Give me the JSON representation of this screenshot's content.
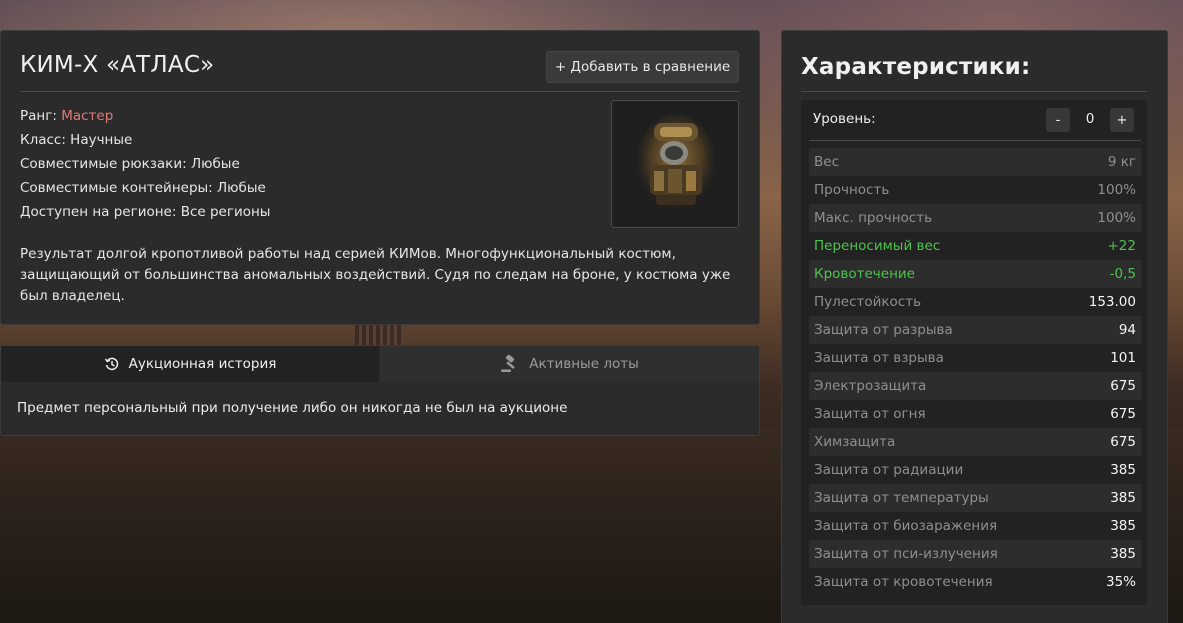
{
  "item": {
    "title": "КИМ-Х «АТЛАС»",
    "compare_label": "+ Добавить в сравнение",
    "rank_label": "Ранг: ",
    "rank_value": "Мастер",
    "class_line": "Класс: Научные",
    "backpacks_line": "Совместимые рюкзаки: Любые",
    "containers_line": "Совместимые контейнеры: Любые",
    "region_line": "Доступен на регионе: Все регионы",
    "description": "Результат долгой кропотливой работы над серией КИМов. Многофункциональный костюм, защищающий от большинства аномальных воздействий. Судя по следам на броне, у костюма уже был владелец."
  },
  "auction": {
    "tab_history": "Аукционная история",
    "tab_lots": "Активные лоты",
    "message": "Предмет персональный при получение либо он никогда не был на аукционе"
  },
  "stats": {
    "title": "Характеристики:",
    "level_label": "Уровень:",
    "level_minus": "-",
    "level_value": "0",
    "level_plus": "+",
    "rows": [
      {
        "name": "Вес",
        "value": "9 кг",
        "style": "dim"
      },
      {
        "name": "Прочность",
        "value": "100%",
        "style": "dim"
      },
      {
        "name": "Макс. прочность",
        "value": "100%",
        "style": "dim"
      },
      {
        "name": "Переносимый вес",
        "value": "+22",
        "style": "green"
      },
      {
        "name": "Кровотечение",
        "value": "-0,5",
        "style": "green"
      },
      {
        "name": "Пулестойкость",
        "value": "153.00",
        "style": "bright"
      },
      {
        "name": "Защита от разрыва",
        "value": "94",
        "style": "bright"
      },
      {
        "name": "Защита от взрыва",
        "value": "101",
        "style": "bright"
      },
      {
        "name": "Электрозащита",
        "value": "675",
        "style": "bright"
      },
      {
        "name": "Защита от огня",
        "value": "675",
        "style": "bright"
      },
      {
        "name": "Химзащита",
        "value": "675",
        "style": "bright"
      },
      {
        "name": "Защита от радиации",
        "value": "385",
        "style": "bright"
      },
      {
        "name": "Защита от температуры",
        "value": "385",
        "style": "bright"
      },
      {
        "name": "Защита от биозаражения",
        "value": "385",
        "style": "bright"
      },
      {
        "name": "Защита от пси-излучения",
        "value": "385",
        "style": "bright"
      },
      {
        "name": "Защита от кровотечения",
        "value": "35%",
        "style": "bright"
      }
    ]
  },
  "colors": {
    "rank": "#e27a74",
    "green": "#4ec34e",
    "panel": "#2b2b2b"
  },
  "icons": {
    "history": "history-icon",
    "gavel": "gavel-icon",
    "item": "suit-image"
  }
}
